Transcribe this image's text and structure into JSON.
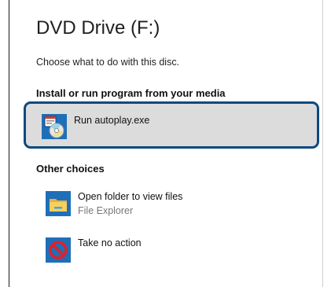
{
  "dialog": {
    "title": "DVD Drive (F:)",
    "subtitle": "Choose what to do with this disc."
  },
  "sections": {
    "install": {
      "heading": "Install or run program from your media",
      "option": {
        "label": "Run autoplay.exe",
        "icon": "autoplay-exe-icon"
      }
    },
    "other": {
      "heading": "Other choices",
      "options": [
        {
          "label": "Open folder to view files",
          "sublabel": "File Explorer",
          "icon": "folder-icon"
        },
        {
          "label": "Take no action",
          "sublabel": "",
          "icon": "no-action-icon"
        }
      ]
    }
  },
  "colors": {
    "selection_border": "#0b4a7f",
    "selection_fill": "#dcdcdc",
    "icon_blue": "#1f6fb8"
  }
}
